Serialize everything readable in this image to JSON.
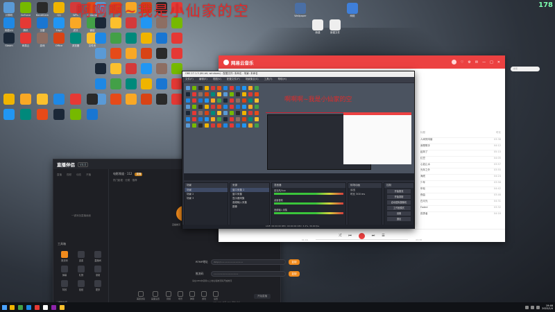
{
  "screen": {
    "corner_counter": "178",
    "lyric_banner": "啊啊啊~我是小仙家的空"
  },
  "desktop_icons": [
    {
      "label": "计算机",
      "color": "#5a9ad6"
    },
    {
      "label": "GeForce",
      "color": "#76b900"
    },
    {
      "label": "BandiCam",
      "color": "#2a2a2a"
    },
    {
      "label": "QQ",
      "color": "#f0b400"
    },
    {
      "label": "WPS",
      "color": "#d43a3a"
    },
    {
      "label": "Chrome",
      "color": "#e64a19"
    },
    {
      "label": "网易UU",
      "color": "#1e88e5"
    },
    {
      "label": "腾讯",
      "color": "#e53935"
    },
    {
      "label": "迅雷",
      "color": "#1976d2"
    },
    {
      "label": "Edge",
      "color": "#2196f3"
    },
    {
      "label": "虎牙",
      "color": "#f9a825"
    },
    {
      "label": "微信",
      "color": "#43a047"
    },
    {
      "label": "Steam",
      "color": "#1b2838"
    },
    {
      "label": "网易云",
      "color": "#e53935"
    },
    {
      "label": "游戏",
      "color": "#8d6e63"
    },
    {
      "label": "Office",
      "color": "#d84315"
    },
    {
      "label": "浏览器",
      "color": "#00897b"
    },
    {
      "label": "文件夹",
      "color": "#fbc02d"
    }
  ],
  "desktop_icons_right": [
    {
      "label": "Wallpaper",
      "color": "#4a6fa5"
    },
    {
      "label": "新建",
      "color": "#eeeeee"
    },
    {
      "label": "新建文件",
      "color": "#eeeeee"
    },
    {
      "label": "网络",
      "color": "#3f7fd9"
    }
  ],
  "live_app": {
    "logo": "直播伴侣",
    "version": "V4.0",
    "window_controls": [
      "—",
      "□",
      "✕"
    ],
    "top_tabs": [
      "直播",
      "视频",
      "动态",
      "开播"
    ],
    "placeholder": "一键添加直播画面",
    "room_title": "电影频道 · 112",
    "room_tag": "直播",
    "room_sub": "热门影视 · 分类 · 推荐",
    "tools_label": "工具箱",
    "tools": [
      {
        "label": "推流码",
        "color": "#f08a1c"
      },
      {
        "label": "连麦",
        "color": "#3a3c44"
      },
      {
        "label": "直播间",
        "color": "#3a3c44"
      },
      {
        "label": "弹幕",
        "color": "#3a3c44"
      },
      {
        "label": "礼物",
        "color": "#3a3c44"
      },
      {
        "label": "录制",
        "color": "#3a3c44"
      },
      {
        "label": "特效",
        "color": "#3a3c44"
      },
      {
        "label": "贴纸",
        "color": "#3a3c44"
      },
      {
        "label": "更多",
        "color": "#3a3c44"
      }
    ],
    "flow": {
      "left_label": "直播推流",
      "num": "7665 185",
      "right_label": "第三方推流"
    },
    "stream_rows": [
      {
        "label": "RTMP地址",
        "value": "rtmp://••••••••••••••••••",
        "button": "复制"
      },
      {
        "label": "推流码",
        "value": "••••••••••••••••••••",
        "button": "复制"
      }
    ],
    "note": "请在OBS中使用以上地址和推流码开始推流",
    "footer_items": [
      "美颜滤镜",
      "画面设置",
      "音频",
      "场景",
      "弹幕",
      "游戏",
      "设置"
    ],
    "go_live": "开始直播",
    "bottom_left": "二维码分享",
    "bottom_tiny": "CPU 12%  内存 45%  网络 良好"
  },
  "music_app": {
    "logo": "网易云音乐",
    "title_controls": [
      "♡",
      "⚙",
      "✉",
      "—",
      "□",
      "✕"
    ],
    "search_placeholder": "搜索",
    "list_header": [
      "标题",
      "时长"
    ],
    "songs": [
      {
        "title": "人间惊鸿客",
        "dur": "03:38"
      },
      {
        "title": "我是歌手",
        "dur": "04:12"
      },
      {
        "title": "起风了",
        "dur": "05:10"
      },
      {
        "title": "红豆",
        "dur": "04:05"
      },
      {
        "title": "心如止水",
        "dur": "03:57"
      },
      {
        "title": "光年之外",
        "dur": "03:55"
      },
      {
        "title": "海底",
        "dur": "04:24"
      },
      {
        "title": "少年",
        "dur": "03:56"
      },
      {
        "title": "年轮",
        "dur": "04:42"
      },
      {
        "title": "夜曲",
        "dur": "03:46"
      },
      {
        "title": "白月光",
        "dur": "04:31"
      },
      {
        "title": "Faded",
        "dur": "03:32"
      },
      {
        "title": "孤勇者",
        "dur": "04:16"
      }
    ],
    "controls": [
      "⤮",
      "⏮",
      "⏯",
      "⏭",
      "☰"
    ],
    "time_left": "01:16",
    "time_right": "03:38"
  },
  "obs": {
    "title": "OBS 27.1.3 (64-bit, windows) - 配置文件: 未命名 - 场景: 未命名",
    "menu": [
      "文件(F)",
      "编辑(E)",
      "视图(V)",
      "配置文件(P)",
      "场景集合(S)",
      "工具(T)",
      "帮助(H)"
    ],
    "preview_lyric": "啊啊啊~我是小仙家的空",
    "docks": {
      "scenes": {
        "header": "场景",
        "rows": [
          "场景",
          "场景 2",
          "场景 3"
        ]
      },
      "sources": {
        "header": "来源",
        "rows": [
          "窗口采集 2",
          "窗口采集",
          "显示器采集",
          "音频输入采集",
          "图像"
        ]
      },
      "mixer": {
        "header": "混音器",
        "tracks": [
          "麦克风/Aux",
          "桌面音频",
          "音频输入采集"
        ]
      },
      "transitions": {
        "header": "转场动画",
        "rows": [
          "淡出",
          "时长 300 ms"
        ]
      },
      "controls": {
        "header": "控制",
        "buttons": [
          "开始推流",
          "开始录制",
          "启动虚拟摄像机",
          "工作室模式",
          "设置",
          "退出"
        ]
      }
    },
    "status": "LIVE: 00:00:00    REC: 00:00:00    CPU: 3.4%, 30.00 fps"
  },
  "taskbar": {
    "pins": [
      {
        "color": "#f0b400"
      },
      {
        "color": "#43a047"
      },
      {
        "color": "#1e88e5"
      },
      {
        "color": "#e53935"
      },
      {
        "color": "#ffffff"
      },
      {
        "color": "#8e24aa"
      },
      {
        "color": "#fbc02d"
      }
    ],
    "clock_time": "19:46",
    "clock_date": "2022/1/4"
  }
}
